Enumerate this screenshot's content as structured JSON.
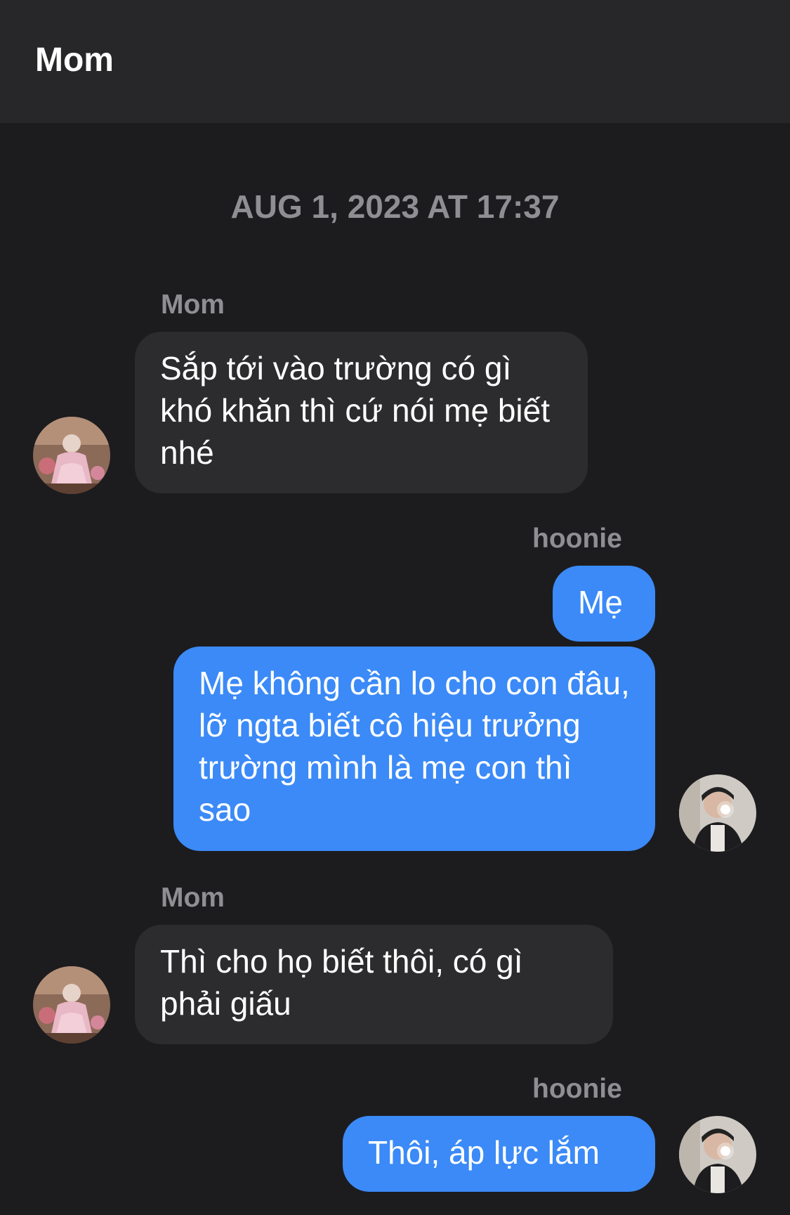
{
  "header": {
    "title": "Mom"
  },
  "timestamp": "AUG 1, 2023 AT 17:37",
  "messages": [
    {
      "sender": "Mom",
      "direction": "incoming",
      "text": "Sắp tới vào trường có gì khó khăn thì cứ nói mẹ biết nhé"
    },
    {
      "sender": "hoonie",
      "direction": "outgoing",
      "text": "Mẹ"
    },
    {
      "sender": "hoonie",
      "direction": "outgoing",
      "text": "Mẹ không cần lo cho con đâu, lỡ ngta biết cô hiệu trưởng trường mình là mẹ con thì sao"
    },
    {
      "sender": "Mom",
      "direction": "incoming",
      "text": "Thì cho họ biết thôi, có gì phải giấu"
    },
    {
      "sender": "hoonie",
      "direction": "outgoing",
      "text": "Thôi, áp lực lắm"
    }
  ],
  "colors": {
    "background": "#1c1c1e",
    "header": "#272729",
    "incoming_bubble": "#2c2c2e",
    "outgoing_bubble": "#3b8af7",
    "meta_text": "#8e8e93"
  }
}
